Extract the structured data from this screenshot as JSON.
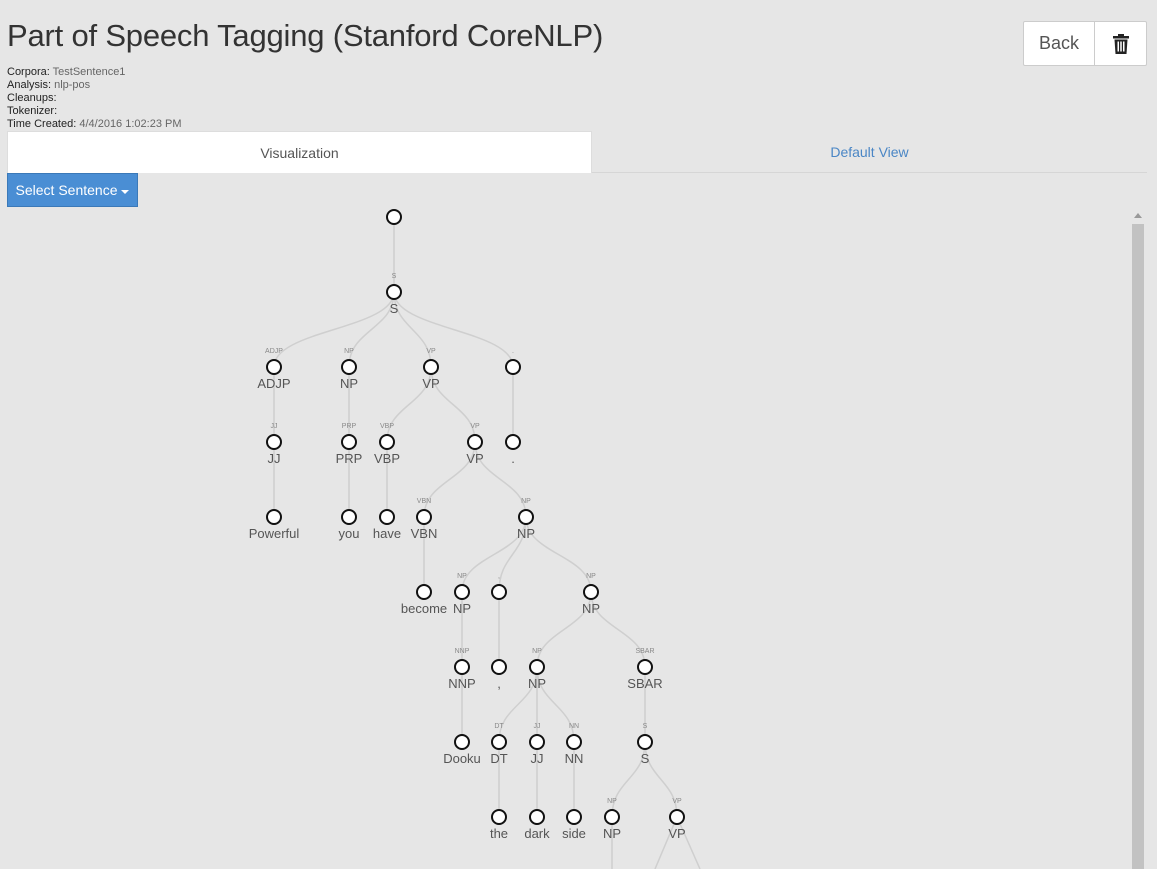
{
  "page": {
    "title": "Part of Speech Tagging (Stanford CoreNLP)"
  },
  "meta": {
    "corpora_label": "Corpora:",
    "corpora_value": "TestSentence1",
    "analysis_label": "Analysis:",
    "analysis_value": "nlp-pos",
    "cleanups_label": "Cleanups:",
    "tokenizer_label": "Tokenizer:",
    "time_label": "Time Created:",
    "time_value": "4/4/2016 1:02:23 PM"
  },
  "toolbar": {
    "back_label": "Back",
    "delete_icon": "trash-icon"
  },
  "tabs": [
    {
      "label": "Visualization",
      "active": true
    },
    {
      "label": "Default View",
      "active": false
    }
  ],
  "select_sentence": {
    "label": "Select Sentence"
  },
  "colors": {
    "accent": "#4a8ed4",
    "link": "#4a86c5",
    "edge": "#cfcfcf",
    "node_stroke": "#111111"
  },
  "tree": {
    "nodes": [
      {
        "id": "root",
        "small": "",
        "label": ""
      },
      {
        "id": "S",
        "small": "S",
        "label": "S"
      },
      {
        "id": "ADJP",
        "small": "ADJP",
        "label": "ADJP"
      },
      {
        "id": "NP1",
        "small": "NP",
        "label": "NP"
      },
      {
        "id": "VP1",
        "small": "VP",
        "label": "VP"
      },
      {
        "id": "P1",
        "small": ".",
        "label": ""
      },
      {
        "id": "JJ1",
        "small": "JJ",
        "label": "JJ"
      },
      {
        "id": "PRP",
        "small": "PRP",
        "label": "PRP"
      },
      {
        "id": "VBP",
        "small": "VBP",
        "label": "VBP"
      },
      {
        "id": "VP2",
        "small": "VP",
        "label": "VP"
      },
      {
        "id": "P2",
        "small": "",
        "label": "."
      },
      {
        "id": "Powerful",
        "small": "",
        "label": "Powerful"
      },
      {
        "id": "you",
        "small": "",
        "label": "you"
      },
      {
        "id": "have",
        "small": "",
        "label": "have"
      },
      {
        "id": "VBN",
        "small": "VBN",
        "label": "VBN"
      },
      {
        "id": "NP2",
        "small": "NP",
        "label": "NP"
      },
      {
        "id": "become",
        "small": "",
        "label": "become"
      },
      {
        "id": "NP3",
        "small": "NP",
        "label": "NP"
      },
      {
        "id": "C1",
        "small": ",",
        "label": ""
      },
      {
        "id": "NP4",
        "small": "NP",
        "label": "NP"
      },
      {
        "id": "NNP",
        "small": "NNP",
        "label": "NNP"
      },
      {
        "id": "C2",
        "small": "",
        "label": ","
      },
      {
        "id": "NP5",
        "small": "NP",
        "label": "NP"
      },
      {
        "id": "SBAR",
        "small": "SBAR",
        "label": "SBAR"
      },
      {
        "id": "Dooku",
        "small": "",
        "label": "Dooku"
      },
      {
        "id": "DT",
        "small": "DT",
        "label": "DT"
      },
      {
        "id": "JJ2",
        "small": "JJ",
        "label": "JJ"
      },
      {
        "id": "NN",
        "small": "NN",
        "label": "NN"
      },
      {
        "id": "S2",
        "small": "S",
        "label": "S"
      },
      {
        "id": "the",
        "small": "",
        "label": "the"
      },
      {
        "id": "dark",
        "small": "",
        "label": "dark"
      },
      {
        "id": "side",
        "small": "",
        "label": "side"
      },
      {
        "id": "NP6",
        "small": "NP",
        "label": "NP"
      },
      {
        "id": "VP3",
        "small": "VP",
        "label": "VP"
      }
    ],
    "edges": [
      [
        "root",
        "S"
      ],
      [
        "S",
        "ADJP"
      ],
      [
        "S",
        "NP1"
      ],
      [
        "S",
        "VP1"
      ],
      [
        "S",
        "P1"
      ],
      [
        "ADJP",
        "JJ1"
      ],
      [
        "NP1",
        "PRP"
      ],
      [
        "VP1",
        "VBP"
      ],
      [
        "VP1",
        "VP2"
      ],
      [
        "P1",
        "P2"
      ],
      [
        "JJ1",
        "Powerful"
      ],
      [
        "PRP",
        "you"
      ],
      [
        "VBP",
        "have"
      ],
      [
        "VP2",
        "VBN"
      ],
      [
        "VP2",
        "NP2"
      ],
      [
        "VBN",
        "become"
      ],
      [
        "NP2",
        "NP3"
      ],
      [
        "NP2",
        "C1"
      ],
      [
        "NP2",
        "NP4"
      ],
      [
        "NP3",
        "NNP"
      ],
      [
        "C1",
        "C2"
      ],
      [
        "NP4",
        "NP5"
      ],
      [
        "NP4",
        "SBAR"
      ],
      [
        "NNP",
        "Dooku"
      ],
      [
        "NP5",
        "DT"
      ],
      [
        "NP5",
        "JJ2"
      ],
      [
        "NP5",
        "NN"
      ],
      [
        "SBAR",
        "S2"
      ],
      [
        "DT",
        "the"
      ],
      [
        "JJ2",
        "dark"
      ],
      [
        "NN",
        "side"
      ],
      [
        "S2",
        "NP6"
      ],
      [
        "S2",
        "VP3"
      ]
    ]
  }
}
